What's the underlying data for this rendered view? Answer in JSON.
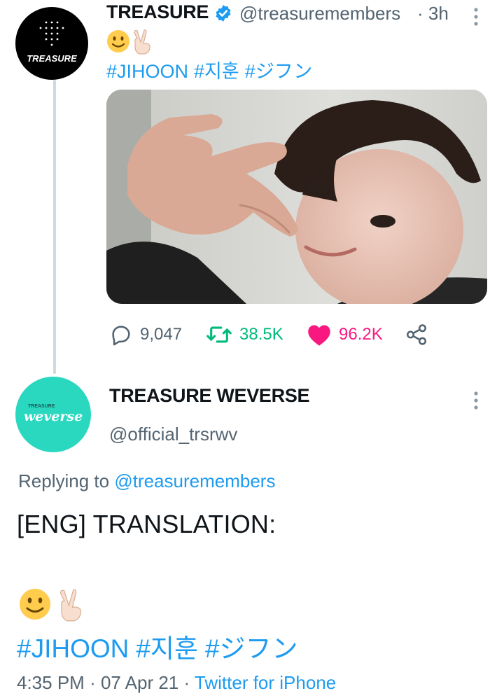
{
  "tweet": {
    "author_name": "TREASURE",
    "author_handle": "@treasuremembers",
    "handle_display": "@treasuremembers",
    "time_ago": "· 3h",
    "avatar_logo_text": "TREASURE",
    "emojis": [
      "slightly-smiling-face",
      "victory-hand"
    ],
    "hashtags": [
      "#JIHOON",
      "#지훈",
      "#ジフン"
    ],
    "stats": {
      "replies": "9,047",
      "retweets": "38.5K",
      "likes": "96.2K"
    },
    "liked": true,
    "colors": {
      "link": "#1d9bf0",
      "retweet": "#00ba7c",
      "like": "#f91880",
      "muted": "#536471"
    }
  },
  "reply": {
    "author_name": "TREASURE WEVERSE",
    "author_handle": "@official_trsrwv",
    "avatar_small_text": "TREASURE",
    "avatar_brand_text": "weverse",
    "avatar_color": "#2ad8c0",
    "replying_prefix": "Replying to",
    "replying_to": "@treasuremembers",
    "body_title": "[ENG] TRANSLATION:",
    "emojis": [
      "slightly-smiling-face",
      "victory-hand"
    ],
    "hashtags": [
      "#JIHOON",
      "#지훈",
      "#ジフン"
    ],
    "time": "4:35 PM",
    "date": "07 Apr 21",
    "source": "Twitter for iPhone"
  }
}
